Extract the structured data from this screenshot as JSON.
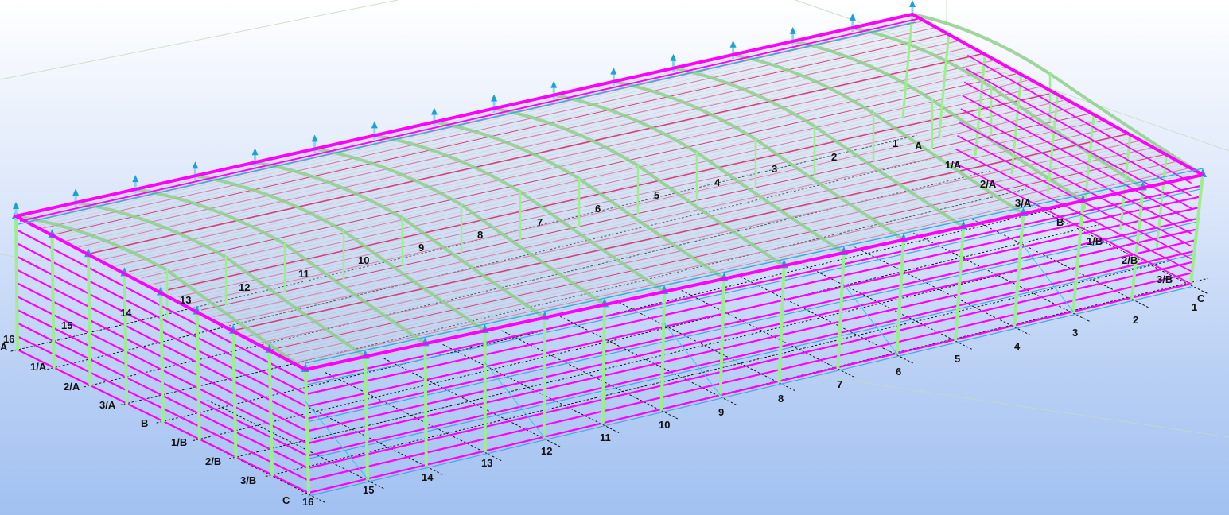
{
  "view": {
    "background_top": "#ffffff",
    "background_bottom": "#a2c1f1",
    "colors": {
      "purlin": "#ff00ff",
      "column": "#9dee8c",
      "rafter": "#8fcf8a",
      "bracing": "#33c6e6",
      "sheeting": "#d93d7a",
      "gridline": "#111111",
      "support": "#1e9fd8"
    }
  },
  "grid_axes": {
    "numbered_bottom": [
      "16",
      "15",
      "14",
      "13",
      "12",
      "11",
      "10",
      "9",
      "8",
      "7",
      "6",
      "5",
      "4",
      "3",
      "2",
      "1"
    ],
    "numbered_roof": [
      "1",
      "2",
      "3",
      "4",
      "5",
      "6",
      "7",
      "8",
      "9",
      "10",
      "11",
      "12",
      "13",
      "14",
      "15",
      "16"
    ],
    "lettered_left": [
      "A",
      "1/A",
      "2/A",
      "3/A",
      "B",
      "1/B",
      "2/B",
      "3/B",
      "C"
    ],
    "lettered_right": [
      "A",
      "1/A",
      "2/A",
      "3/A",
      "B",
      "1/B",
      "2/B",
      "3/B",
      "C"
    ]
  }
}
